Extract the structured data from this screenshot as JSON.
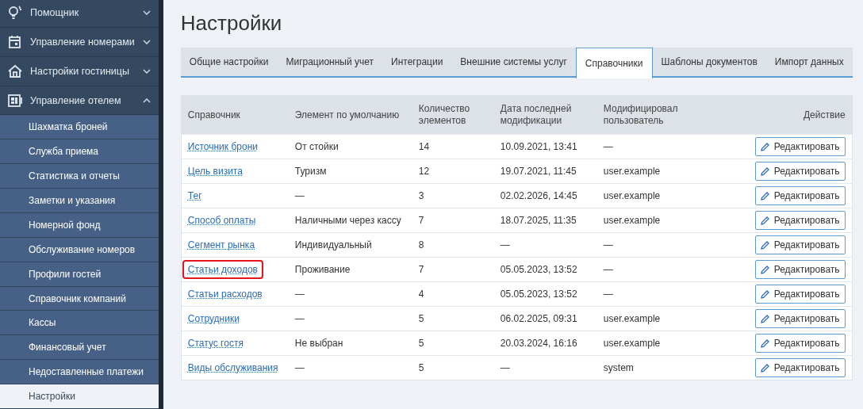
{
  "sidebar": {
    "groups": [
      {
        "label": "Помощник",
        "kind": "bulb",
        "expanded": false
      },
      {
        "label": "Управление номерами",
        "kind": "calendar",
        "expanded": false
      },
      {
        "label": "Настройки гостиницы",
        "kind": "house",
        "expanded": false
      },
      {
        "label": "Управление отелем",
        "kind": "board",
        "expanded": true,
        "children": [
          {
            "label": "Шахматка броней",
            "selected": false
          },
          {
            "label": "Служба приема",
            "selected": false
          },
          {
            "label": "Статистика и отчеты",
            "selected": false
          },
          {
            "label": "Заметки и указания",
            "selected": false
          },
          {
            "label": "Номерной фонд",
            "selected": false
          },
          {
            "label": "Обслуживание номеров",
            "selected": false
          },
          {
            "label": "Профили гостей",
            "selected": false
          },
          {
            "label": "Справочник компаний",
            "selected": false
          },
          {
            "label": "Кассы",
            "selected": false
          },
          {
            "label": "Финансовый учет",
            "selected": false
          },
          {
            "label": "Недоставленные платежи",
            "selected": false
          },
          {
            "label": "Настройки",
            "selected": true
          }
        ]
      }
    ]
  },
  "page_title": "Настройки",
  "tabs": [
    {
      "label": "Общие настройки",
      "selected": false
    },
    {
      "label": "Миграционный учет",
      "selected": false
    },
    {
      "label": "Интеграции",
      "selected": false
    },
    {
      "label": "Внешние системы услуг",
      "selected": false
    },
    {
      "label": "Справочники",
      "selected": true
    },
    {
      "label": "Шаблоны документов",
      "selected": false
    },
    {
      "label": "Импорт данных",
      "selected": false
    }
  ],
  "table": {
    "columns": [
      "Справочник",
      "Элемент по умолчанию",
      "Количество элементов",
      "Дата последней модификации",
      "Модифицировал пользователь",
      "Действие"
    ],
    "rows": [
      {
        "name": "Источник брони",
        "default": "От стойки",
        "count": "14",
        "date": "10.09.2021, 13:41",
        "user": "—",
        "action": "Редактировать",
        "highlighted": false
      },
      {
        "name": "Цель визита",
        "default": "Туризм",
        "count": "12",
        "date": "19.07.2021, 11:45",
        "user": "user.example",
        "action": "Редактировать",
        "highlighted": false
      },
      {
        "name": "Тег",
        "default": "—",
        "count": "3",
        "date": "02.02.2026, 14:45",
        "user": "user.example",
        "action": "Редактировать",
        "highlighted": false
      },
      {
        "name": "Способ оплаты",
        "default": "Наличными через кассу",
        "count": "7",
        "date": "18.07.2025, 11:35",
        "user": "user.example",
        "action": "Редактировать",
        "highlighted": false
      },
      {
        "name": "Сегмент рынка",
        "default": "Индивидуальный",
        "count": "8",
        "date": "—",
        "user": "—",
        "action": "Редактировать",
        "highlighted": false
      },
      {
        "name": "Статьи доходов",
        "default": "Проживание",
        "count": "7",
        "date": "05.05.2023, 13:52",
        "user": "—",
        "action": "Редактировать",
        "highlighted": true
      },
      {
        "name": "Статьи расходов",
        "default": "—",
        "count": "4",
        "date": "05.05.2023, 13:52",
        "user": "—",
        "action": "Редактировать",
        "highlighted": false
      },
      {
        "name": "Сотрудники",
        "default": "—",
        "count": "5",
        "date": "06.02.2025, 09:31",
        "user": "user.example",
        "action": "Редактировать",
        "highlighted": false
      },
      {
        "name": "Статус гостя",
        "default": "Не выбран",
        "count": "5",
        "date": "20.03.2024, 16:16",
        "user": "user.example",
        "action": "Редактировать",
        "highlighted": false
      },
      {
        "name": "Виды обслуживания",
        "default": "—",
        "count": "5",
        "date": "—",
        "user": "system",
        "action": "Редактировать",
        "highlighted": false
      }
    ]
  }
}
